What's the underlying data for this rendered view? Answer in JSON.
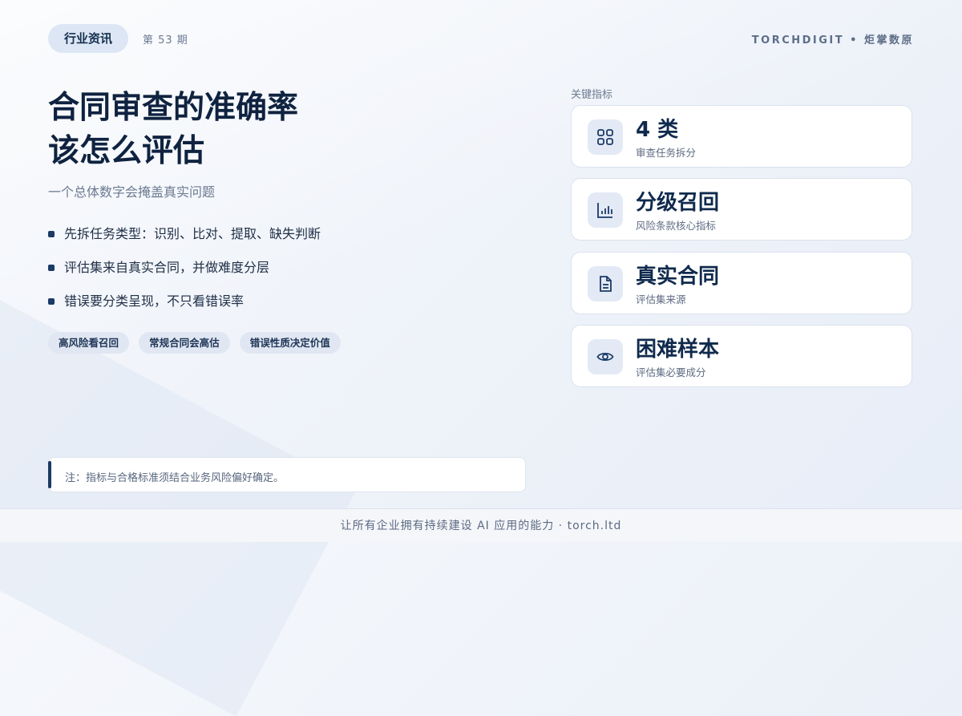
{
  "header": {
    "tag": "行业资讯",
    "issue": "第 53 期",
    "brand": "TORCHDIGIT • 炬掌数原"
  },
  "title_lines": [
    "合同审查的准确率",
    "该怎么评估"
  ],
  "subtitle": "一个总体数字会掩盖真实问题",
  "bullets": [
    "先拆任务类型：识别、比对、提取、缺失判断",
    "评估集来自真实合同，并做难度分层",
    "错误要分类呈现，不只看错误率"
  ],
  "chips": [
    "高风险看召回",
    "常规合同会高估",
    "错误性质决定价值"
  ],
  "note": "注：指标与合格标准须结合业务风险偏好确定。",
  "metrics": {
    "label": "关键指标",
    "items": [
      {
        "icon": "grid-icon",
        "value": "4 类",
        "label": "审查任务拆分"
      },
      {
        "icon": "bar-chart-icon",
        "value": "分级召回",
        "label": "风险条款核心指标"
      },
      {
        "icon": "document-icon",
        "value": "真实合同",
        "label": "评估集来源"
      },
      {
        "icon": "eye-icon",
        "value": "困难样本",
        "label": "评估集必要成分"
      }
    ]
  },
  "footer": "让所有企业拥有持续建设 AI 应用的能力 · torch.ltd",
  "colors": {
    "accent": "#1b3a66",
    "title": "#0f2340",
    "chip_bg": "#e0e7f2"
  }
}
